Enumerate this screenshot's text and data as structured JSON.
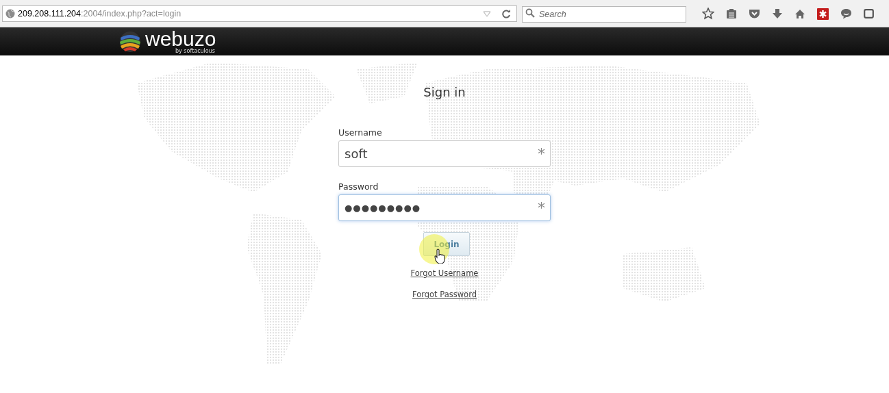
{
  "browser": {
    "url": {
      "host": "209.208.111.204",
      "path": ":2004/index.php?act=login"
    },
    "search": {
      "placeholder": "Search"
    }
  },
  "header": {
    "logo": {
      "name": "webuzo",
      "tagline": "by softaculous"
    }
  },
  "form": {
    "title": "Sign in",
    "fields": [
      {
        "label": "Username",
        "value": "soft",
        "required_mark": "*",
        "focused": false
      },
      {
        "label": "Password",
        "value": "●●●●●●●●●",
        "required_mark": "*",
        "focused": true
      }
    ],
    "button": "Login",
    "links": [
      "Forgot Username",
      "Forgot Password"
    ]
  }
}
